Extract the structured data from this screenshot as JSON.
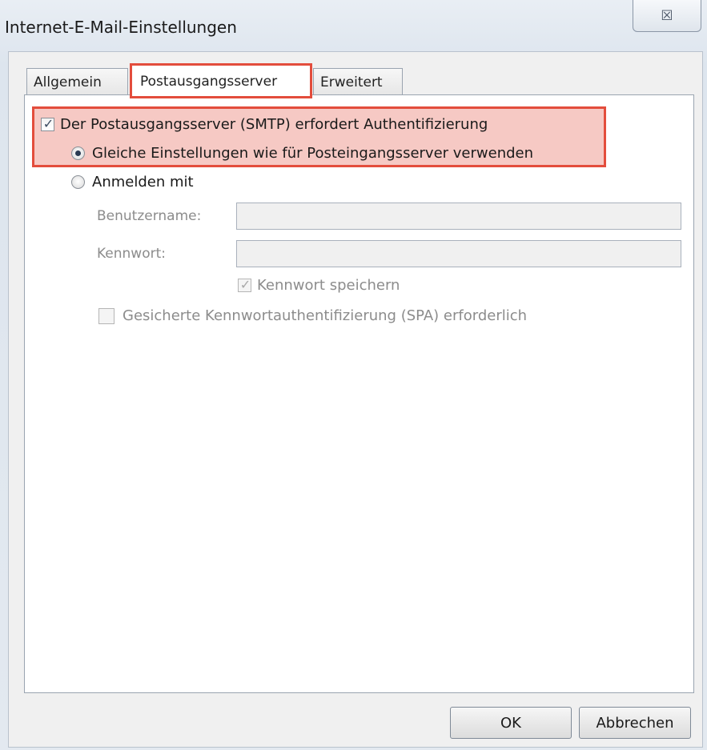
{
  "window": {
    "title": "Internet-E-Mail-Einstellungen",
    "close_glyph": "☒"
  },
  "tabs": [
    {
      "label": "Allgemein"
    },
    {
      "label": "Postausgangsserver"
    },
    {
      "label": "Erweitert"
    }
  ],
  "outgoing": {
    "smtp_auth_label": "Der Postausgangsserver (SMTP) erfordert Authentifizierung",
    "smtp_auth_checked": true,
    "same_settings_label": "Gleiche Einstellungen wie für Posteingangsserver verwenden",
    "same_settings_selected": true,
    "login_with_label": "Anmelden mit",
    "login_with_selected": false,
    "username_label": "Benutzername:",
    "username_value": "",
    "password_label": "Kennwort:",
    "password_value": "",
    "save_password_label": "Kennwort speichern",
    "save_password_checked": true,
    "spa_label": "Gesicherte Kennwortauthentifizierung (SPA) erforderlich",
    "spa_checked": false
  },
  "buttons": {
    "ok": "OK",
    "cancel": "Abbrechen"
  },
  "colors": {
    "highlight_border": "#e34d3c",
    "highlight_fill": "#f6c9c4"
  }
}
